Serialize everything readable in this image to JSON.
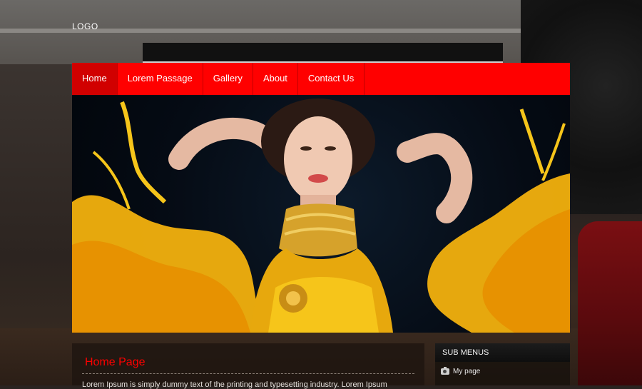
{
  "header": {
    "logo": "LOGO"
  },
  "nav": {
    "items": [
      {
        "label": "Home",
        "active": true
      },
      {
        "label": "Lorem Passage",
        "active": false
      },
      {
        "label": "Gallery",
        "active": false
      },
      {
        "label": "About",
        "active": false
      },
      {
        "label": "Contact Us",
        "active": false
      }
    ],
    "colors": {
      "bar": "#ff0000",
      "active": "#d10000"
    }
  },
  "main": {
    "title": "Home Page",
    "text": "Lorem Ipsum is simply dummy text of the printing and typesetting industry. Lorem Ipsum"
  },
  "sidebar": {
    "title": "SUB MENUS",
    "items": [
      {
        "icon": "camera-icon",
        "label": "My page"
      }
    ]
  }
}
